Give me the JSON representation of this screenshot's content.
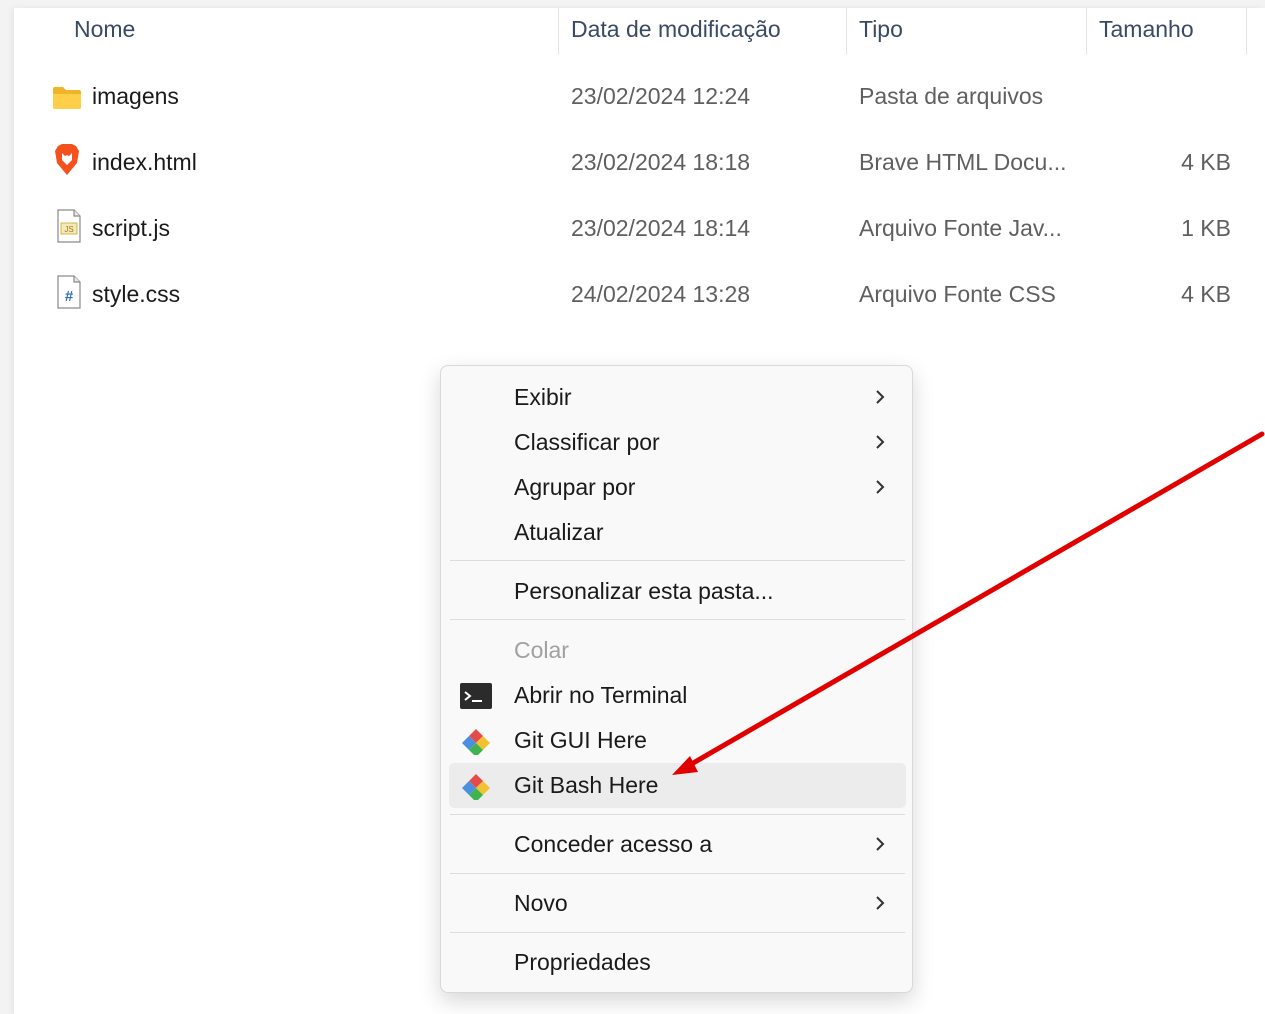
{
  "columns": {
    "name": "Nome",
    "date": "Data de modificação",
    "type": "Tipo",
    "size": "Tamanho"
  },
  "files": [
    {
      "icon": "folder-icon",
      "name": "imagens",
      "date": "23/02/2024 12:24",
      "type": "Pasta de arquivos",
      "size": ""
    },
    {
      "icon": "brave-html-icon",
      "name": "index.html",
      "date": "23/02/2024 18:18",
      "type": "Brave HTML Docu...",
      "size": "4 KB"
    },
    {
      "icon": "js-file-icon",
      "name": "script.js",
      "date": "23/02/2024 18:14",
      "type": "Arquivo Fonte Jav...",
      "size": "1 KB"
    },
    {
      "icon": "css-file-icon",
      "name": "style.css",
      "date": "24/02/2024 13:28",
      "type": "Arquivo Fonte CSS",
      "size": "4 KB"
    }
  ],
  "context_menu": {
    "exibir": "Exibir",
    "classificar": "Classificar por",
    "agrupar": "Agrupar por",
    "atualizar": "Atualizar",
    "personalizar": "Personalizar esta pasta...",
    "colar": "Colar",
    "terminal": "Abrir no Terminal",
    "git_gui": "Git GUI Here",
    "git_bash": "Git Bash Here",
    "conceder": "Conceder acesso a",
    "novo": "Novo",
    "propriedades": "Propriedades"
  },
  "annotation": {
    "type": "arrow",
    "color": "#e00000",
    "points_to": "Git Bash Here"
  }
}
